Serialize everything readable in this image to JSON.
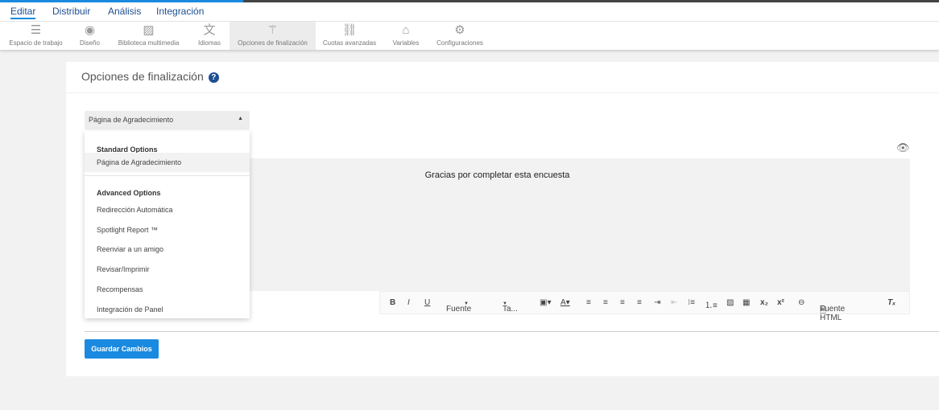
{
  "nav": {
    "tabs": [
      "Editar",
      "Distribuir",
      "Análisis",
      "Integración"
    ],
    "active": "Editar"
  },
  "tools": [
    {
      "label": "Espacio de trabajo",
      "icon": "workspace-icon"
    },
    {
      "label": "Diseño",
      "icon": "palette-icon"
    },
    {
      "label": "Biblioteca multimedia",
      "icon": "image-icon"
    },
    {
      "label": "Idiomas",
      "icon": "language-icon"
    },
    {
      "label": "Opciones de finalización",
      "icon": "magic-wand-icon"
    },
    {
      "label": "Cuotas avanzadas",
      "icon": "quotas-icon"
    },
    {
      "label": "Variables",
      "icon": "tag-icon"
    },
    {
      "label": "Configuraciones",
      "icon": "gear-icon"
    }
  ],
  "page": {
    "title": "Opciones de finalización",
    "help": "?"
  },
  "select": {
    "value": "Página de Agradecimiento"
  },
  "dropdown": {
    "standard_header": "Standard Options",
    "standard": [
      "Página de Agradecimiento"
    ],
    "advanced_header": "Advanced Options",
    "advanced": [
      "Redirección Automática",
      "Spotlight Report ™",
      "Reenviar a un amigo",
      "Revisar/Imprimir",
      "Recompensas",
      "Integración de Panel"
    ]
  },
  "editor": {
    "content": "Gracias por completar esta encuesta"
  },
  "toolbar": {
    "font": "Fuente",
    "size": "Ta...",
    "html_source": "Fuente HTML"
  },
  "save_label": "Guardar Cambios",
  "colors": {
    "accent": "#1a8ae0",
    "nav_text": "#1d4f91"
  }
}
